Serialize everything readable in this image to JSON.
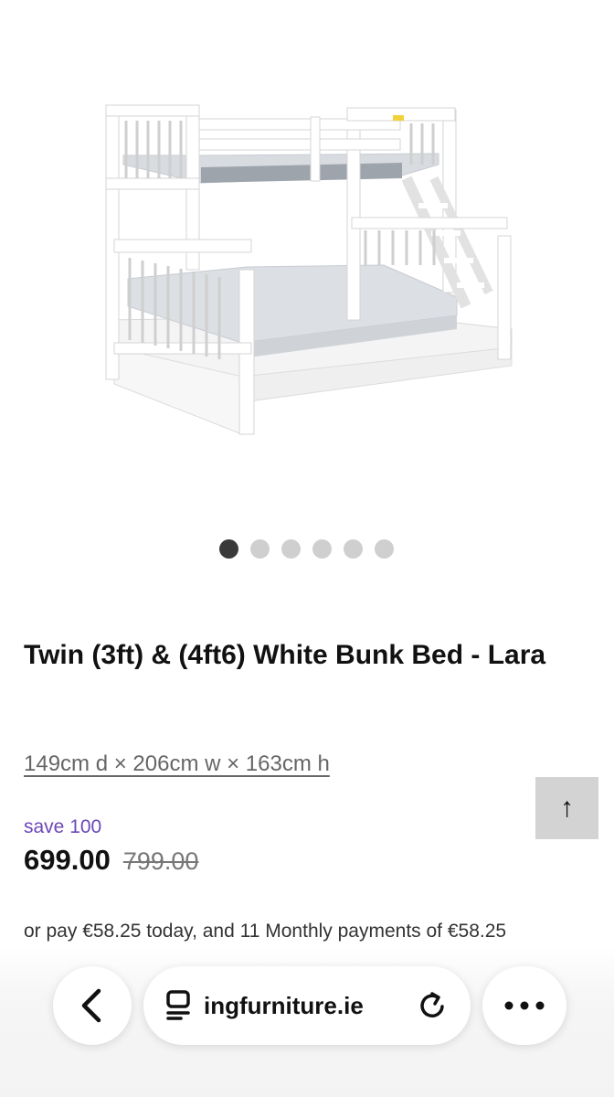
{
  "product": {
    "title": "Twin (3ft) & (4ft6) White Bunk Bed - Lara",
    "dimensions": "149cm d × 206cm w × 163cm h",
    "save_label": "save 100",
    "price": "699.00",
    "original_price": "799.00",
    "finance_text": "or pay €58.25 today, and 11 Monthly payments of €58.25"
  },
  "carousel": {
    "total_images": 6,
    "active_index": 0
  },
  "browser": {
    "url": "ingfurniture.ie"
  },
  "icons": {
    "back": "chevron-left-icon",
    "page": "page-menu-icon",
    "reload": "reload-icon",
    "more": "more-dots-icon",
    "scroll_top": "arrow-up-icon"
  },
  "colors": {
    "save_accent": "#6b47b8",
    "active_dot": "#3a3a3a",
    "inactive_dot": "#cfcfcf"
  },
  "scroll_top_label": "↑"
}
